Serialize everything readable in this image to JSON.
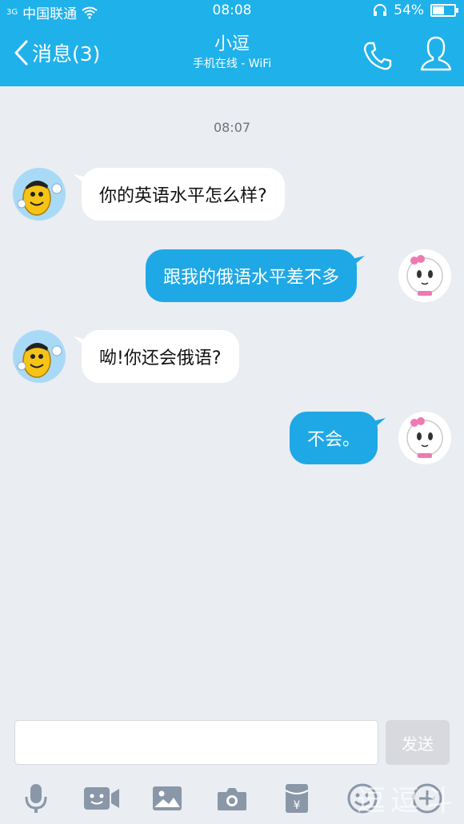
{
  "status_bar": {
    "signal": "3G",
    "carrier": "中国联通",
    "time": "08:08",
    "battery_text": "54%",
    "battery_level": 0.54
  },
  "nav": {
    "back_label": "消息(3)",
    "contact_name": "小逗",
    "contact_status": "手机在线 - WiFi"
  },
  "chat": {
    "timestamp": "08:07",
    "messages": [
      {
        "from": "received",
        "text": "你的英语水平怎么样?"
      },
      {
        "from": "sent",
        "text": "跟我的俄语水平差不多"
      },
      {
        "from": "received",
        "text": "呦!你还会俄语?"
      },
      {
        "from": "sent",
        "text": "不会。"
      }
    ]
  },
  "composer": {
    "input_value": "",
    "send_label": "发送"
  },
  "toolbar": {
    "icons": [
      "microphone-icon",
      "video-icon",
      "image-icon",
      "camera-icon",
      "red-packet-icon",
      "emoji-icon",
      "plus-icon"
    ]
  },
  "watermark": "逗逗斗",
  "colors": {
    "header": "#1fb1ea",
    "sent_bubble": "#1fa8e6",
    "background": "#eaedf2"
  }
}
